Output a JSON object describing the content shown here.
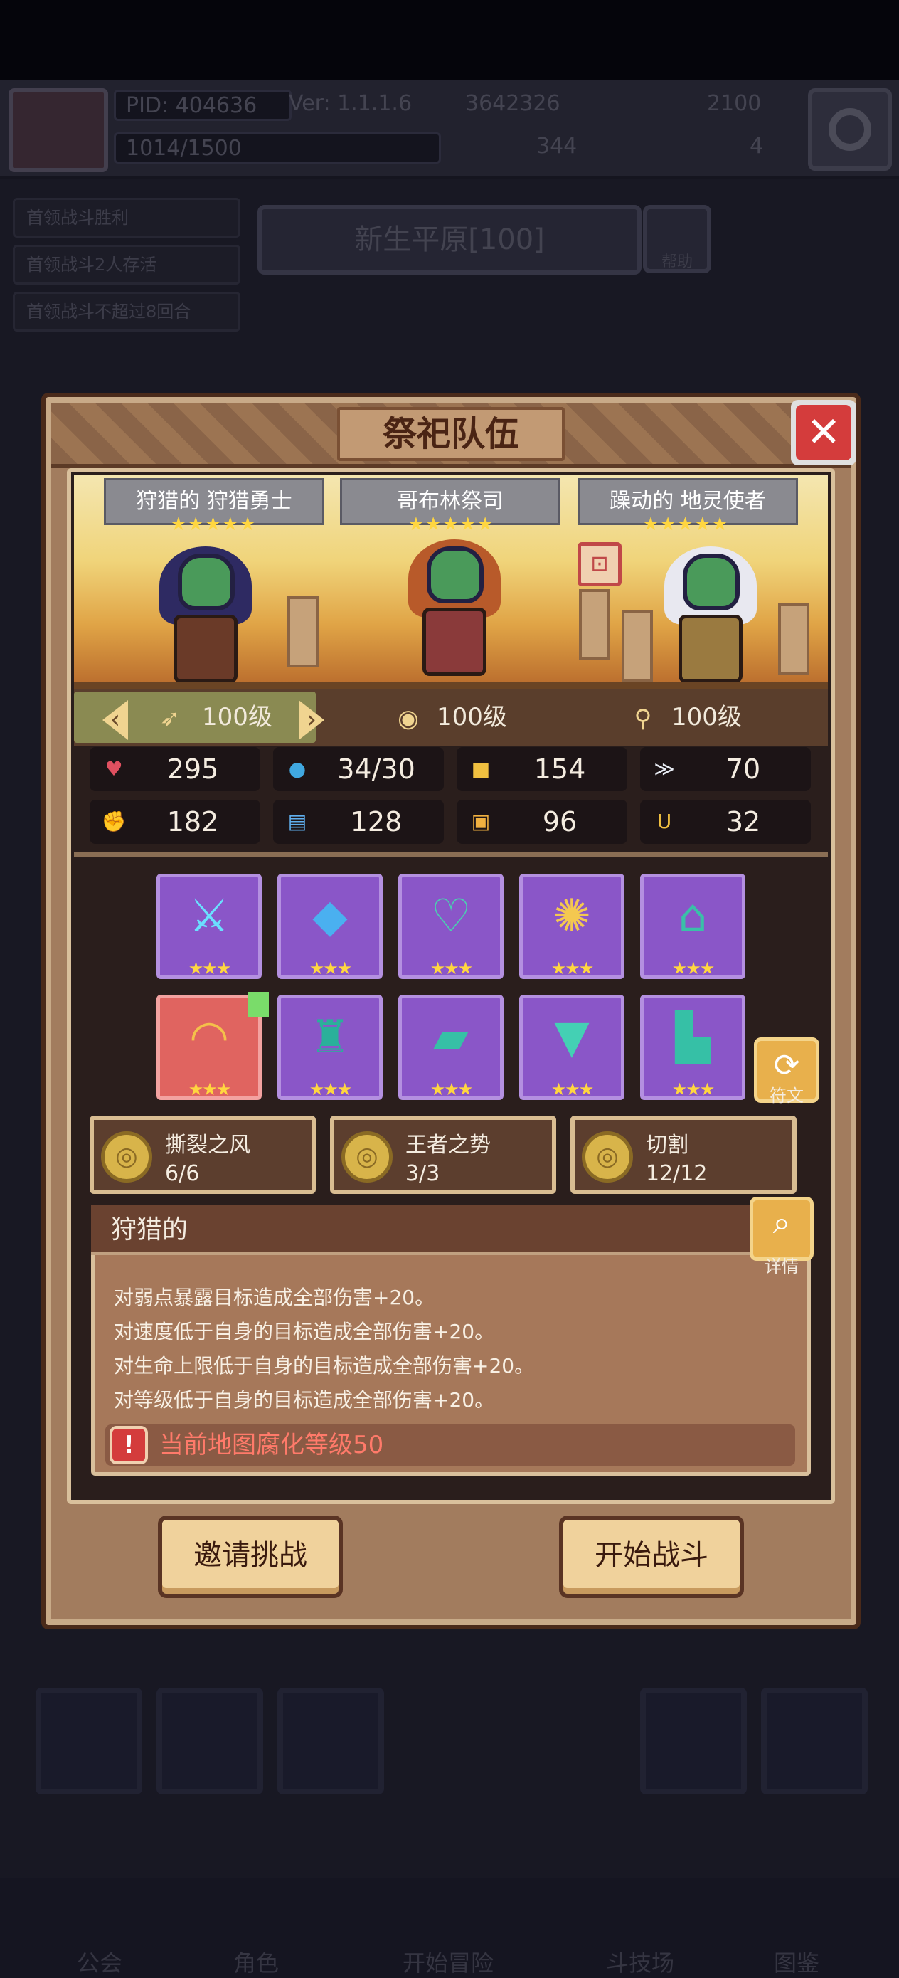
{
  "background": {
    "pid": "PID: 404636",
    "version": "Ver: 1.1.1.6",
    "gold": "3642326",
    "gems": "2100",
    "energy": "1014/1500",
    "clover": "344",
    "keys": "4",
    "quests": [
      "首领战斗胜利",
      "首领战斗2人存活",
      "首领战斗不超过8回合"
    ],
    "map_name": "新生平原[100]",
    "help_label": "帮助",
    "nav": [
      "公会",
      "角色",
      "开始冒险",
      "斗技场",
      "图鉴"
    ]
  },
  "dialog": {
    "title": "祭祀队伍",
    "close_glyph": "✕",
    "heroes": [
      {
        "name": "狩猎的 狩猎勇士",
        "stars": "★★★★★",
        "level": "100级",
        "class_icon": "bow-icon"
      },
      {
        "name": "哥布林祭司",
        "stars": "★★★★★",
        "level": "100级",
        "class_icon": "orb-icon"
      },
      {
        "name": "躁动的 地灵使者",
        "stars": "★★★★★",
        "level": "100级",
        "class_icon": "staff-icon"
      }
    ],
    "stats": [
      {
        "icon": "heart-icon",
        "glyph": "♥",
        "value": "295",
        "color": "#e05060"
      },
      {
        "icon": "mana-drop-icon",
        "glyph": "●",
        "value": "34/30",
        "color": "#40a8e0"
      },
      {
        "icon": "shield-icon",
        "glyph": "■",
        "value": "154",
        "color": "#f0c040"
      },
      {
        "icon": "wing-icon",
        "glyph": "≫",
        "value": "70",
        "color": "#e8ecf4"
      },
      {
        "icon": "fist-icon",
        "glyph": "✊",
        "value": "182",
        "color": "#f08070"
      },
      {
        "icon": "book-icon",
        "glyph": "▤",
        "value": "128",
        "color": "#60b0f0"
      },
      {
        "icon": "armor-icon",
        "glyph": "▣",
        "value": "96",
        "color": "#f0b040"
      },
      {
        "icon": "horseshoe-icon",
        "glyph": "U",
        "value": "32",
        "color": "#f0c040"
      }
    ],
    "equipment": [
      {
        "name": "ice-sword",
        "glyph": "⚔",
        "stars": "★★★",
        "color": "#6ae0ff"
      },
      {
        "name": "rune-card",
        "glyph": "◆",
        "stars": "★★★",
        "color": "#4ab0f0"
      },
      {
        "name": "heart-necklace",
        "glyph": "♡",
        "stars": "★★★",
        "color": "#4ad0b0"
      },
      {
        "name": "golden-shell",
        "glyph": "✺",
        "stars": "★★★",
        "color": "#f4c850"
      },
      {
        "name": "teal-helmet",
        "glyph": "⌂",
        "stars": "★★★",
        "color": "#3ac0a8"
      },
      {
        "name": "straw-hat",
        "glyph": "◠",
        "stars": "★★★",
        "color": "#f4c04a"
      },
      {
        "name": "teal-armor",
        "glyph": "♜",
        "stars": "★★★",
        "color": "#2ab09a"
      },
      {
        "name": "teal-bracer",
        "glyph": "▰",
        "stars": "★★★",
        "color": "#36c0a6"
      },
      {
        "name": "teal-belt",
        "glyph": "▼",
        "stars": "★★★",
        "color": "#44d0b4"
      },
      {
        "name": "teal-boots",
        "glyph": "▙",
        "stars": "★★★",
        "color": "#36c0a6"
      }
    ],
    "rune_label": "符文",
    "sets": [
      {
        "name": "撕裂之风",
        "count": "6/6"
      },
      {
        "name": "王者之势",
        "count": "3/3"
      },
      {
        "name": "切割",
        "count": "12/12"
      }
    ],
    "trait": {
      "title": "狩猎的",
      "detail_label": "详情",
      "lines": [
        "对弱点暴露目标造成全部伤害+20。",
        "对速度低于自身的目标造成全部伤害+20。",
        "对生命上限低于自身的目标造成全部伤害+20。",
        "对等级低于自身的目标造成全部伤害+20。"
      ]
    },
    "warning": "当前地图腐化等级50",
    "invite_label": "邀请挑战",
    "start_label": "开始战斗"
  }
}
